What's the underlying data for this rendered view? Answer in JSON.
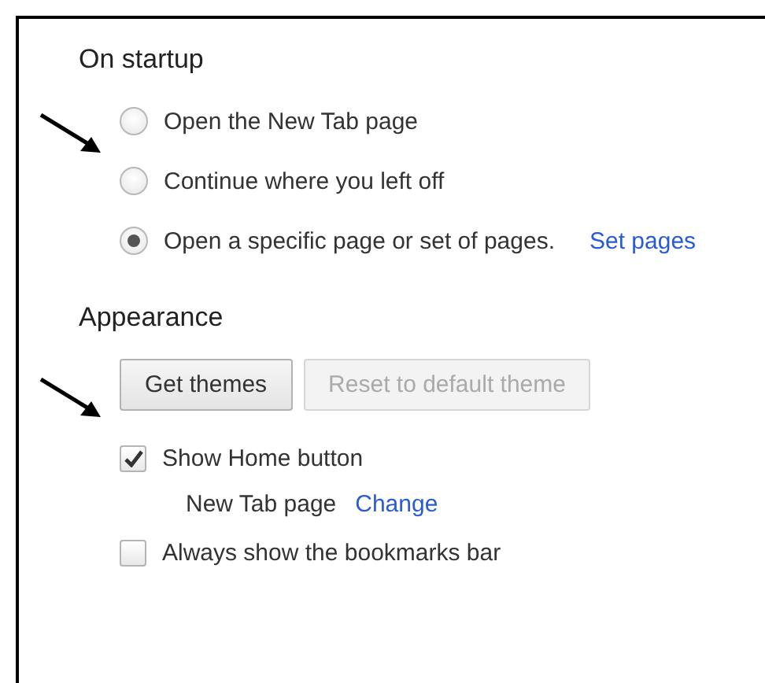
{
  "sections": [
    {
      "title": "On startup",
      "kind": "radios",
      "options": [
        {
          "label": "Open the New Tab page",
          "selected": false
        },
        {
          "label": "Continue where you left off",
          "selected": false
        },
        {
          "label": "Open a specific page or set of pages.",
          "selected": true,
          "link": "Set pages"
        }
      ]
    },
    {
      "title": "Appearance",
      "kind": "appearance",
      "buttons": [
        {
          "label": "Get themes",
          "disabled": false
        },
        {
          "label": "Reset to default theme",
          "disabled": true
        }
      ],
      "checks": [
        {
          "label": "Show Home button",
          "checked": true,
          "sub": {
            "label": "New Tab page",
            "link": "Change"
          }
        },
        {
          "label": "Always show the bookmarks bar",
          "checked": false
        }
      ]
    }
  ]
}
